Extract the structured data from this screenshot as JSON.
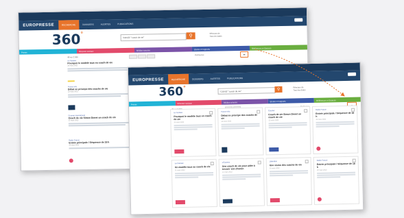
{
  "brand": "EUROPRESSE",
  "product": "360",
  "nav": [
    "RECHERCHE",
    "DOSSIERS",
    "ALERTES",
    "PUBLICATIONS"
  ],
  "search": {
    "query": "\"COVID\" \"coach de vie\"",
    "button_icon": "search-icon"
  },
  "search_options": [
    "Réseaux de",
    "Tous les dates"
  ],
  "tabs": [
    "Presse",
    "Réseaux sociaux",
    "Médias sonores",
    "Etudes et rapports",
    "Références et Sources"
  ],
  "back_toolbar": {
    "count": "48 sur 2 596",
    "sort": "Pertinence"
  },
  "front_toolbar": {
    "count": "48 sur 2 596",
    "sort": "Pertinence"
  },
  "view_toggle_icon": "grid-view-icon",
  "back_list": [
    {
      "source": "Le Parisien",
      "title": "Pourquoi le modèle tous en coach de vie",
      "meta": "23 mars 2022"
    },
    {
      "source": "France Info",
      "title": "Débat en principe des coachs de vie",
      "meta": "23 mars 2022"
    },
    {
      "source": "Courrier international",
      "title": "Coach de vie Simon Donet un coach de vie",
      "meta": "22 mars 2022"
    },
    {
      "source": "Radio France",
      "title": "Entrée principale / Séquence de 18 h",
      "meta": "22 mars 2022"
    }
  ],
  "cards": [
    {
      "source": "Le Parisien",
      "title": "Pourquoi le modèle tous en coach de vie",
      "meta": "23 mars 2022",
      "logo_color": "#e24a6b"
    },
    {
      "source": "France Info",
      "title": "Débat en principe des coachs de vie",
      "meta": "23 mars 2022",
      "logo_color": "#1b3a5c"
    },
    {
      "source": "Courrier",
      "title": "Coach de vie Simon Donet un coach de vie",
      "meta": "22 mars 2022",
      "logo_color": "#3c5aa8"
    },
    {
      "source": "Radio France",
      "title": "Entrée principale / Séquence de 18 h",
      "meta": "22 mars 2022",
      "logo_color": "#e24a6b"
    },
    {
      "source": "Le Parisien",
      "title": "Un modèle tous en coach de vie",
      "meta": "21 mars 2022",
      "logo_color": "#e24a6b"
    },
    {
      "source": "L'Express",
      "title": "Une coach de vie pour aider à trouver son chemin",
      "meta": "21 mars 2022",
      "logo_color": "#1b3a5c"
    },
    {
      "source": "Libération",
      "title": "Une vision des coachs de vie",
      "meta": "20 mars 2022",
      "logo_color": "#e24a6b"
    },
    {
      "source": "Radio France",
      "title": "Entrée principale / Séquence de 18 h",
      "meta": "20 mars 2022",
      "logo_color": "#e24a6b"
    }
  ],
  "colors": {
    "brand_bar": "#23476e",
    "accent": "#e8742b",
    "highlight": "#f3d34a"
  }
}
